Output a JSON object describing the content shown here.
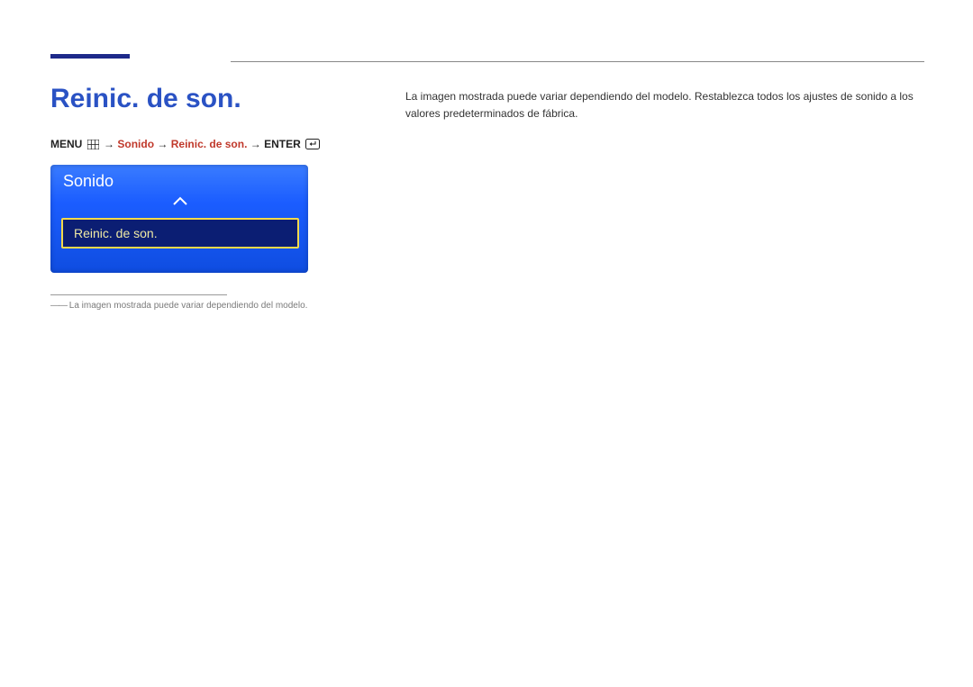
{
  "heading": "Reinic. de son.",
  "breadcrumb": {
    "menu_label": "MENU",
    "arrow": "→",
    "path1": "Sonido",
    "path2": "Reinic. de son.",
    "enter_label": "ENTER"
  },
  "menu_panel": {
    "title": "Sonido",
    "selected_item": "Reinic. de son."
  },
  "footnote": {
    "dash": "――",
    "text": "La imagen mostrada puede variar dependiendo del modelo."
  },
  "body_text": "La imagen mostrada puede variar dependiendo del modelo. Restablezca todos los ajustes de sonido a los valores predeterminados de fábrica.",
  "icons": {
    "menu_icon": "menu-grid",
    "enter_icon": "enter-return"
  }
}
